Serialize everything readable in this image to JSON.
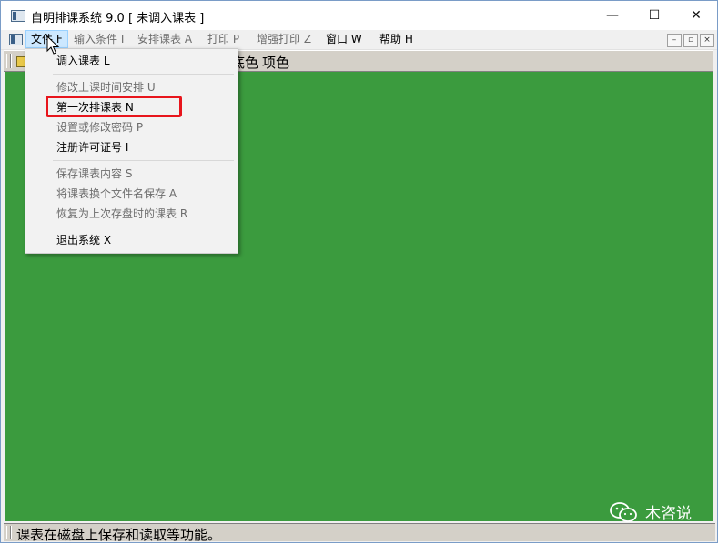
{
  "window": {
    "title": "自明排课系统 9.0 [ 未调入课表 ]",
    "controls": {
      "minimize": "—",
      "maximize": "☐",
      "close": "✕"
    }
  },
  "menubar": {
    "items": [
      {
        "label": "文件 F",
        "state": "active"
      },
      {
        "label": "输入条件 I",
        "state": "disabled"
      },
      {
        "label": "安排课表 A",
        "state": "disabled"
      },
      {
        "label": "打印 P",
        "state": "disabled"
      },
      {
        "label": "增强打印 Z",
        "state": "disabled"
      },
      {
        "label": "窗口 W",
        "state": "enabled"
      },
      {
        "label": "帮助 H",
        "state": "enabled"
      }
    ],
    "mdi_controls": {
      "minimize": "–",
      "restore": "▫",
      "close": "×"
    }
  },
  "toolbar": {
    "text1": "底色",
    "text2": "项色"
  },
  "file_menu": {
    "items": [
      {
        "label": "调入课表 L",
        "state": "enabled"
      },
      {
        "label": "修改上课时间安排 U",
        "state": "disabled"
      },
      {
        "label": "第一次排课表 N",
        "state": "enabled",
        "highlighted": true
      },
      {
        "label": "设置或修改密码 P",
        "state": "disabled"
      },
      {
        "label": "注册许可证号 I",
        "state": "enabled"
      },
      {
        "label": "保存课表内容 S",
        "state": "disabled"
      },
      {
        "label": "将课表换个文件名保存 A",
        "state": "disabled"
      },
      {
        "label": "恢复为上次存盘时的课表 R",
        "state": "disabled"
      },
      {
        "label": "退出系统 X",
        "state": "enabled"
      }
    ]
  },
  "statusbar": {
    "text": "课表在磁盘上保存和读取等功能。"
  },
  "watermark": {
    "text": "木咨说",
    "icon": "wechat-icon"
  },
  "colors": {
    "workspace": "#3b9b3e",
    "highlight_border": "#e8151c",
    "active_menu": "#cce8ff"
  }
}
